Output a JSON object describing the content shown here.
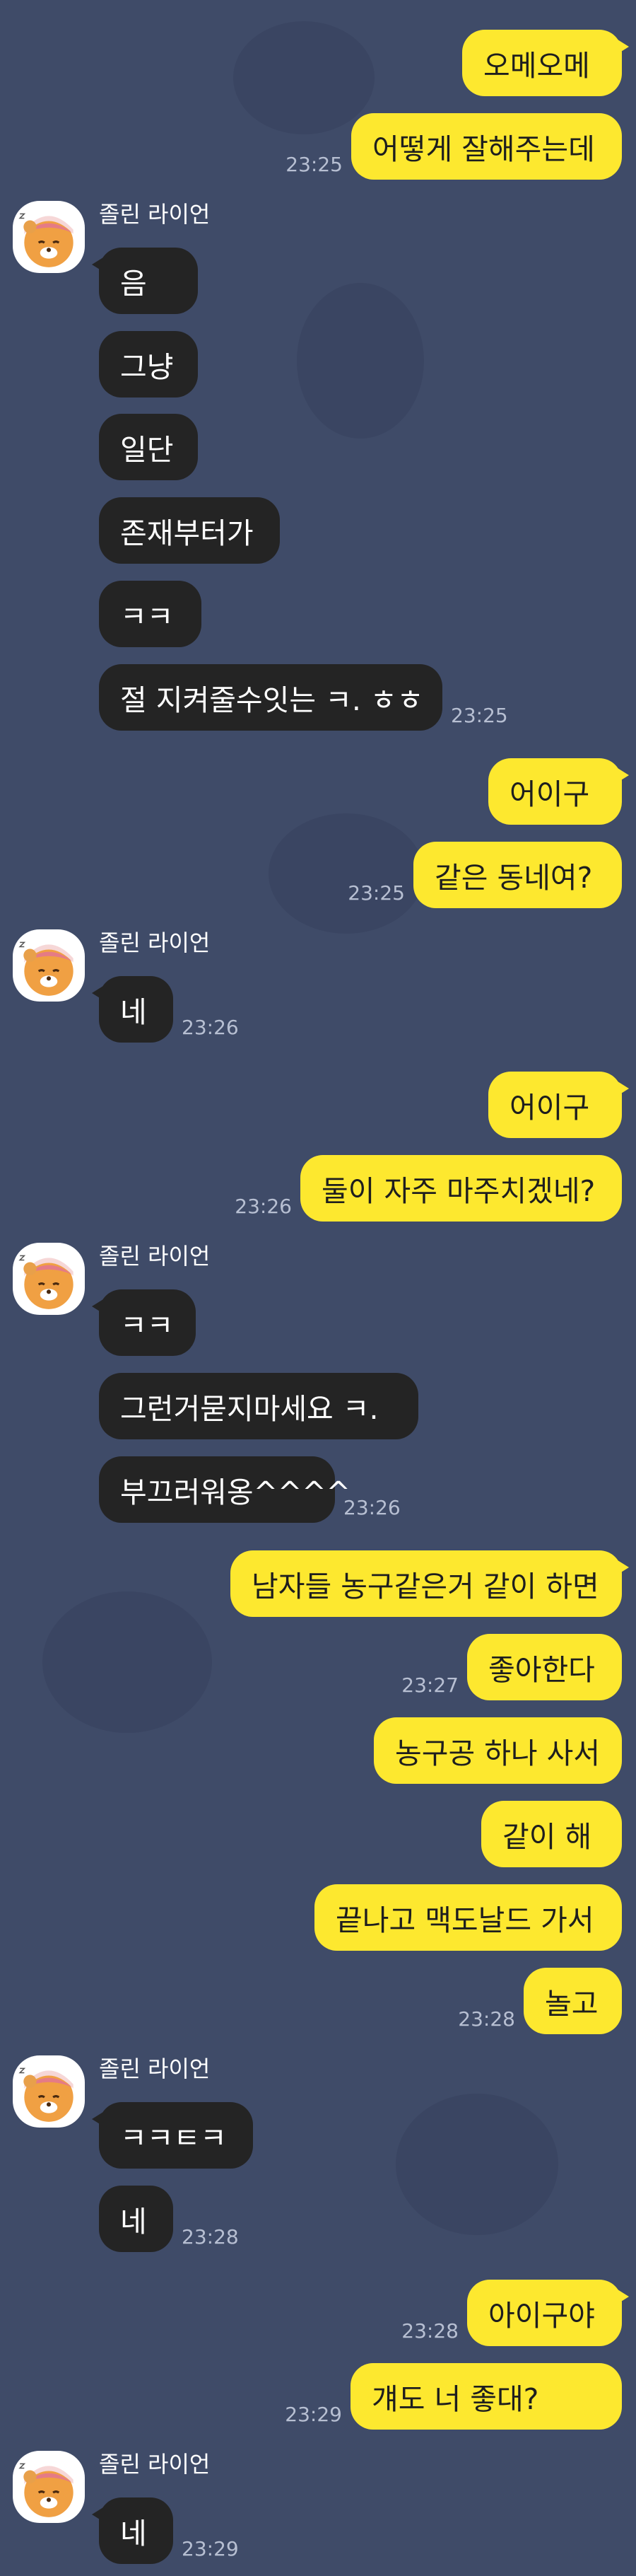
{
  "chat": {
    "sender_name": "졸린 라이언",
    "colors": {
      "background": "#3f4b68",
      "my_bubble": "#fde82f",
      "their_bubble": "#242424",
      "time_text": "#b7bfd2"
    },
    "avatar_icon": "ryan-sleeping-icon",
    "messages": [
      {
        "from": "me",
        "text": "오메오메"
      },
      {
        "from": "me",
        "text": "어떻게 잘해주는데",
        "time": "23:25"
      },
      {
        "from": "them",
        "text": "음",
        "show_sender": true
      },
      {
        "from": "them",
        "text": "그냥"
      },
      {
        "from": "them",
        "text": "일단"
      },
      {
        "from": "them",
        "text": "존재부터가"
      },
      {
        "from": "them",
        "text": "ㅋㅋ"
      },
      {
        "from": "them",
        "text": "절 지켜줄수잇는 ㅋ. ㅎㅎ",
        "time": "23:25"
      },
      {
        "from": "me",
        "text": "어이구"
      },
      {
        "from": "me",
        "text": "같은 동네여?",
        "time": "23:25"
      },
      {
        "from": "them",
        "text": "네",
        "time": "23:26",
        "show_sender": true
      },
      {
        "from": "me",
        "text": "어이구"
      },
      {
        "from": "me",
        "text": "둘이 자주 마주치겠네?",
        "time": "23:26"
      },
      {
        "from": "them",
        "text": "ㅋㅋ",
        "show_sender": true
      },
      {
        "from": "them",
        "text": "그런거묻지마세요 ㅋ."
      },
      {
        "from": "them",
        "text": "부끄러워옹^^^^",
        "time": "23:26"
      },
      {
        "from": "me",
        "text": "남자들 농구같은거 같이 하면"
      },
      {
        "from": "me",
        "text": "좋아한다",
        "time": "23:27"
      },
      {
        "from": "me",
        "text": "농구공 하나 사서"
      },
      {
        "from": "me",
        "text": "같이 해"
      },
      {
        "from": "me",
        "text": "끝나고 맥도날드 가서"
      },
      {
        "from": "me",
        "text": "놀고",
        "time": "23:28"
      },
      {
        "from": "them",
        "text": "ㅋㅋㅌㅋ",
        "show_sender": true
      },
      {
        "from": "them",
        "text": "네",
        "time": "23:28"
      },
      {
        "from": "me",
        "text": "아이구야",
        "time": "23:28"
      },
      {
        "from": "me",
        "text": "걔도 너 좋대?",
        "time": "23:29"
      },
      {
        "from": "them",
        "text": "네",
        "time": "23:29",
        "show_sender": true
      }
    ]
  }
}
